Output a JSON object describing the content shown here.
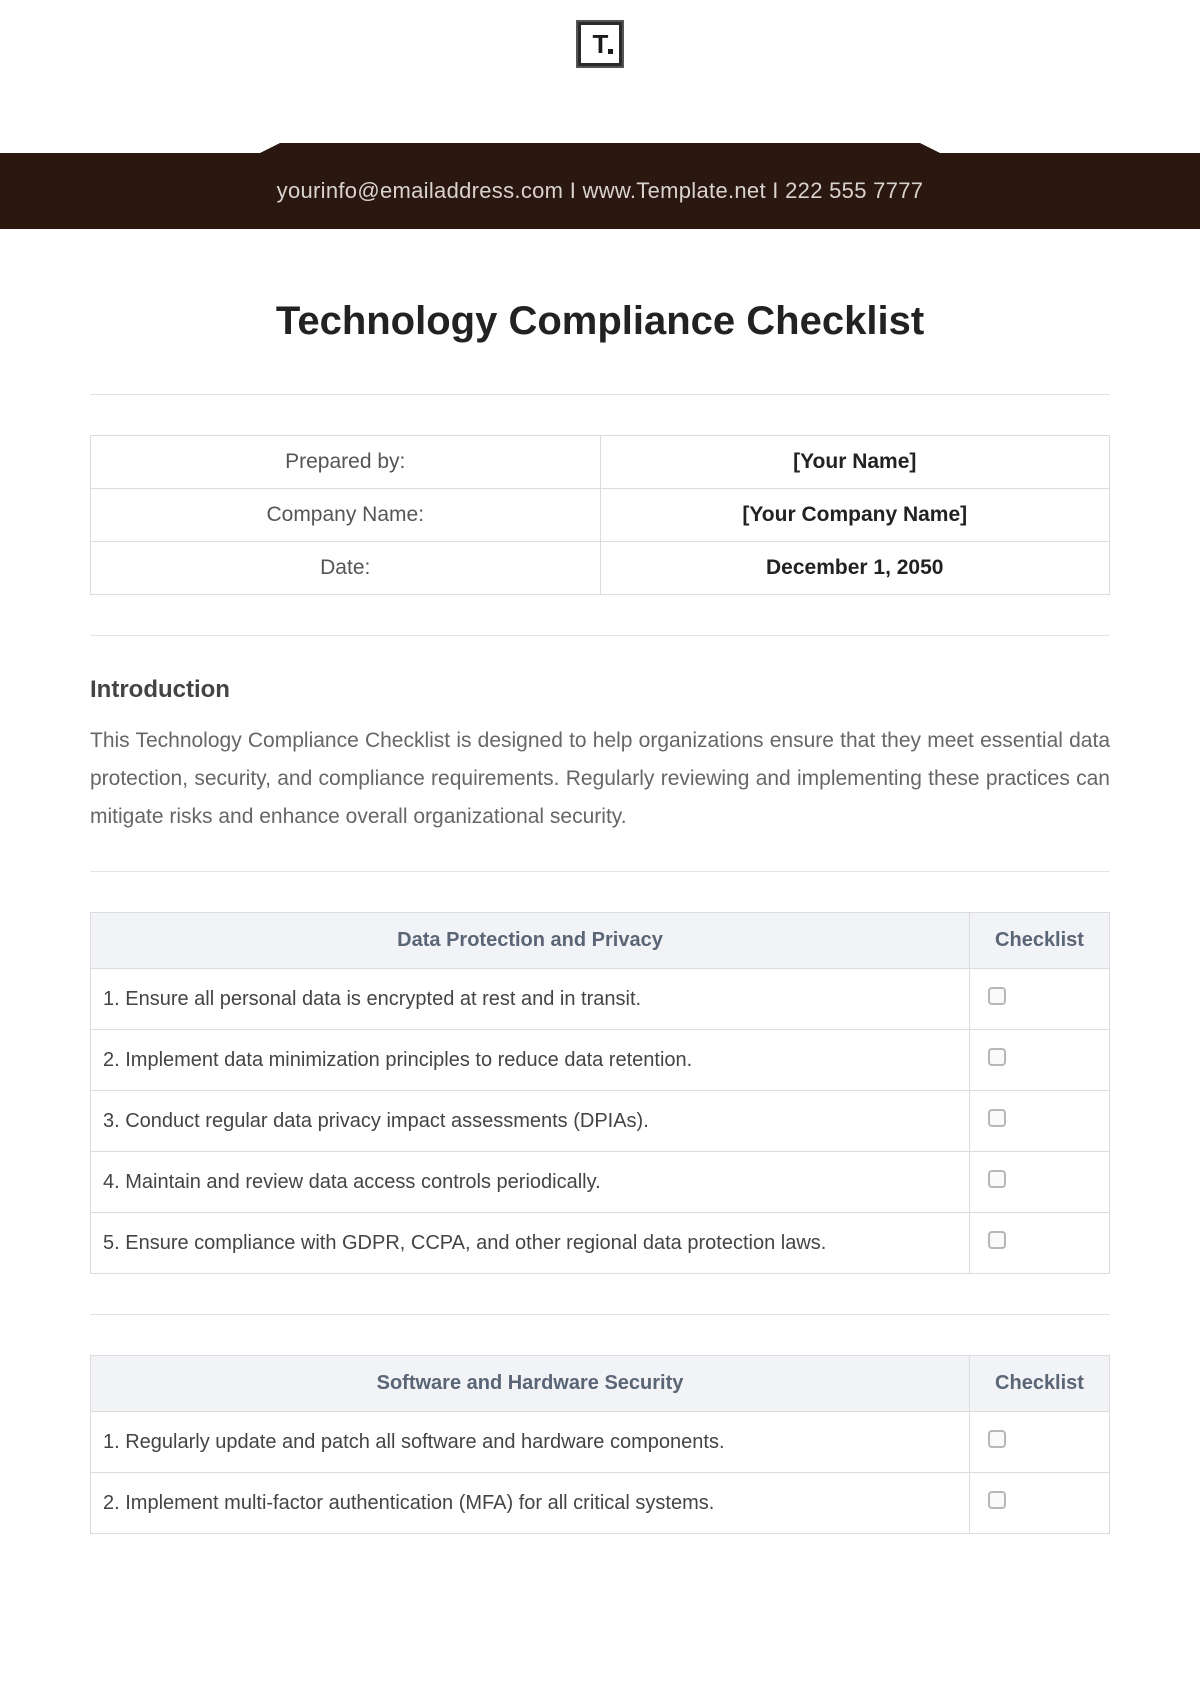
{
  "logo": {
    "letter": "T"
  },
  "banner": {
    "email": "yourinfo@emailaddress.com",
    "sep": "  I  ",
    "site": "www.Template.net",
    "phone": "222 555 7777"
  },
  "title": "Technology Compliance Checklist",
  "meta": {
    "rows": [
      {
        "label": "Prepared by:",
        "value": "[Your Name]"
      },
      {
        "label": "Company Name:",
        "value": "[Your Company Name]"
      },
      {
        "label": "Date:",
        "value": "December 1, 2050"
      }
    ]
  },
  "intro": {
    "heading": "Introduction",
    "body": "This Technology Compliance Checklist is designed to help organizations ensure that they meet essential data protection, security, and compliance requirements. Regularly reviewing and implementing these practices can mitigate risks and enhance overall organizational security."
  },
  "section1": {
    "header": "Data Protection and Privacy",
    "col2": "Checklist",
    "items": [
      "1. Ensure all personal data is encrypted at rest and in transit.",
      "2. Implement data minimization principles to reduce data retention.",
      "3. Conduct regular data privacy impact assessments (DPIAs).",
      "4. Maintain and review data access controls periodically.",
      "5. Ensure compliance with GDPR, CCPA, and other regional data protection laws."
    ]
  },
  "section2": {
    "header": "Software and Hardware Security",
    "col2": "Checklist",
    "items": [
      "1. Regularly update and patch all software and hardware components.",
      "2. Implement multi-factor authentication (MFA) for all critical systems."
    ]
  }
}
